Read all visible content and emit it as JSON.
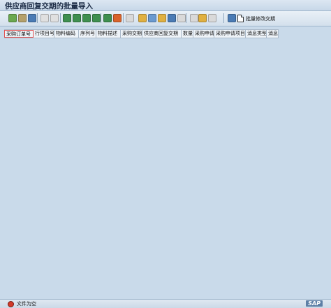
{
  "window": {
    "title": "供应商回复交期的批量导入"
  },
  "toolbar": {
    "buttons": [
      {
        "name": "zoom-icon",
        "color": "#6aa84f"
      },
      {
        "name": "save-layout-icon",
        "color": "#b4a06a"
      },
      {
        "name": "refresh-icon",
        "color": "#4a7bb5"
      },
      {
        "name": "select-all-icon",
        "color": "#e0e0e0"
      },
      {
        "name": "deselect-all-icon",
        "color": "#e0e0e0"
      },
      {
        "name": "sort-asc-icon",
        "color": "#3f8f4f"
      },
      {
        "name": "sort-desc-icon",
        "color": "#3f8f4f"
      },
      {
        "name": "filter-icon",
        "color": "#3f8f4f"
      },
      {
        "name": "find-icon",
        "color": "#3f8f4f"
      },
      {
        "name": "subtotal-icon",
        "color": "#3f8f4f"
      },
      {
        "name": "total-icon",
        "color": "#d9632b"
      },
      {
        "name": "print-icon",
        "color": "#d9d9d9"
      },
      {
        "name": "export-icon",
        "color": "#e0b040"
      },
      {
        "name": "mail-icon",
        "color": "#6a9ad0"
      },
      {
        "name": "graphic-icon",
        "color": "#e0b040"
      },
      {
        "name": "abc-analysis-icon",
        "color": "#4a7bb5"
      },
      {
        "name": "word-processing-icon",
        "color": "#d9d9d9"
      },
      {
        "name": "change-layout-icon",
        "color": "#d9d9d9"
      },
      {
        "name": "choose-layout-icon",
        "color": "#e0b040"
      },
      {
        "name": "details-icon",
        "color": "#d9d9d9"
      },
      {
        "name": "information-icon",
        "color": "#4a7bb5"
      }
    ],
    "batch_change_label": "批量修改交期"
  },
  "table": {
    "columns": [
      "采购订单号",
      "行项目号",
      "物料编码",
      "序列号",
      "物料描述",
      "采购交期",
      "供应商回复交期",
      "数量",
      "采购申请",
      "采购申请项目",
      "消息类型",
      "消息"
    ]
  },
  "status": {
    "text": "文件为空"
  },
  "brand": {
    "label": "SAP"
  }
}
